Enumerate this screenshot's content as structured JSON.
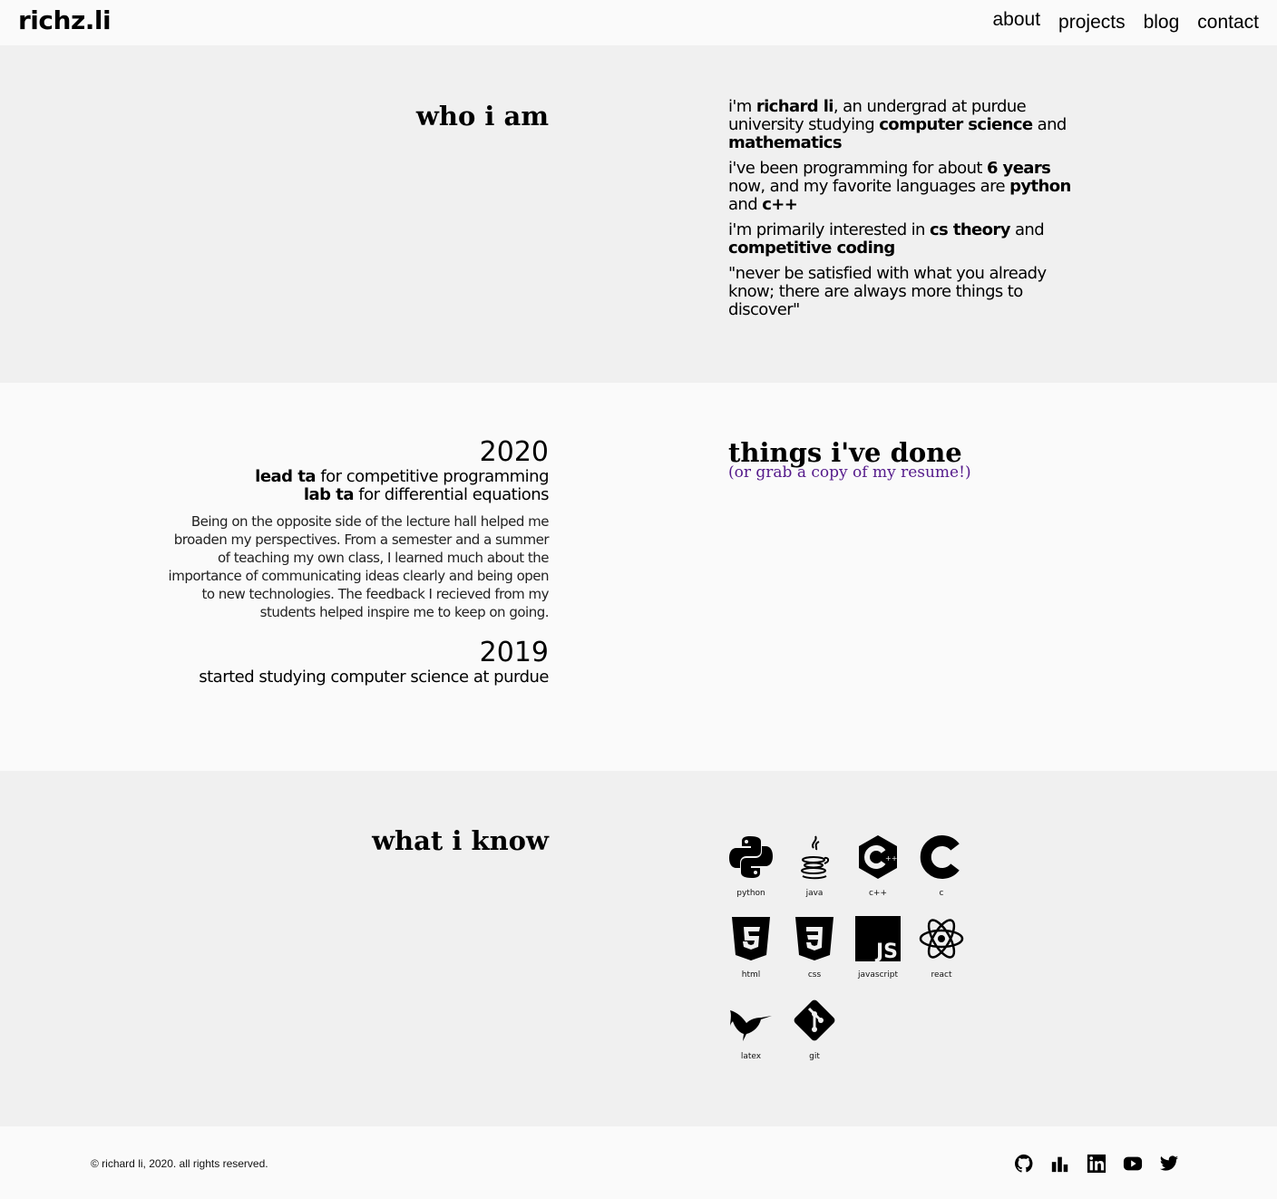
{
  "header": {
    "logo": "richz.li",
    "nav": [
      {
        "label": "about"
      },
      {
        "label": "projects"
      },
      {
        "label": "blog"
      },
      {
        "label": "contact"
      }
    ]
  },
  "about": {
    "title": "who i am",
    "p1": {
      "a": "i'm ",
      "b": "richard li",
      "c": ", an undergrad at purdue university studying ",
      "d": "computer science",
      "e": " and ",
      "f": "mathematics"
    },
    "p2": {
      "a": "i've been programming for about ",
      "b": "6 years",
      "c": " now, and my favorite languages are ",
      "d": "python",
      "e": " and ",
      "f": "c++"
    },
    "p3": {
      "a": "i'm primarily interested in ",
      "b": "cs theory",
      "c": " and ",
      "d": "competitive coding"
    },
    "quote": "\"never be satisfied with what you already know; there are always more things to discover\""
  },
  "experience": {
    "title": "things i've done",
    "resume_link": "(or grab a copy of my resume!)",
    "entries": [
      {
        "year": "2020",
        "role1_bold": "lead ta",
        "role1_rest": " for competitive programming",
        "role2_bold": "lab ta",
        "role2_rest": " for differential equations",
        "description": "Being on the opposite side of the lecture hall helped me broaden my perspectives. From a semester and a summer of teaching my own class, I learned much about the importance of communicating ideas clearly and being open to new technologies. The feedback I recieved from my students helped inspire me to keep on going."
      },
      {
        "year": "2019",
        "text": "started studying computer science at purdue"
      }
    ]
  },
  "skills": {
    "title": "what i know",
    "items": [
      {
        "label": "python",
        "icon": "python-icon"
      },
      {
        "label": "java",
        "icon": "java-icon"
      },
      {
        "label": "c++",
        "icon": "cplusplus-icon"
      },
      {
        "label": "c",
        "icon": "c-icon"
      },
      {
        "label": "html",
        "icon": "html5-icon"
      },
      {
        "label": "css",
        "icon": "css3-icon"
      },
      {
        "label": "javascript",
        "icon": "javascript-icon"
      },
      {
        "label": "react",
        "icon": "react-icon"
      },
      {
        "label": "latex",
        "icon": "latex-icon"
      },
      {
        "label": "git",
        "icon": "git-icon"
      }
    ]
  },
  "footer": {
    "copyright": "© richard li, 2020. all rights reserved.",
    "social": [
      "github-icon",
      "stats-icon",
      "linkedin-icon",
      "youtube-icon",
      "twitter-icon"
    ]
  }
}
